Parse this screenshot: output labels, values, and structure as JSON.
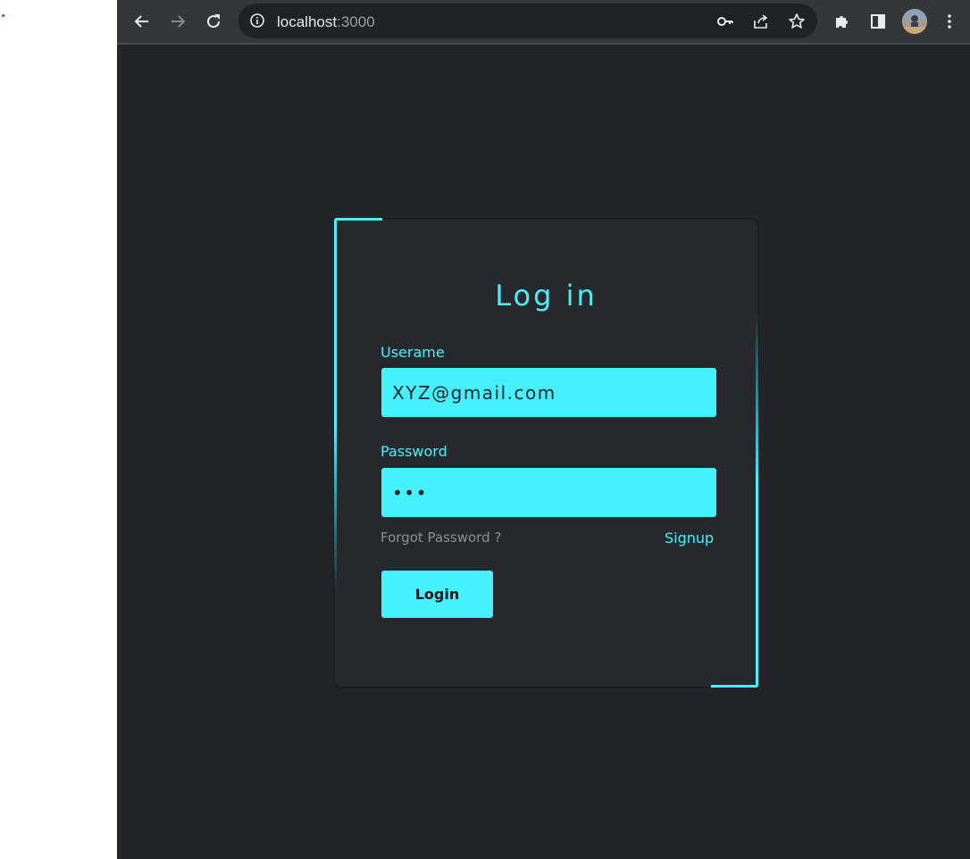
{
  "browser": {
    "url_host": "localhost",
    "url_port": ":3000",
    "icons": {
      "back": "arrow-left-icon",
      "forward": "arrow-right-icon",
      "reload": "reload-icon",
      "site_info": "info-icon",
      "password": "key-icon",
      "share": "share-icon",
      "bookmark": "star-icon",
      "extensions": "puzzle-icon",
      "side_panel": "side-panel-icon",
      "menu": "kebab-menu-icon"
    }
  },
  "login": {
    "title": "Log in",
    "username_label": "Userame",
    "username_value": "XYZ@gmail.com",
    "password_label": "Password",
    "password_value": "•••",
    "forgot_password": "Forgot Password ?",
    "signup": "Signup",
    "login_button": "Login"
  },
  "colors": {
    "accent": "#44f1fd",
    "page_background": "#232428",
    "card_background": "#27282c",
    "muted_text": "#8e8f93"
  }
}
